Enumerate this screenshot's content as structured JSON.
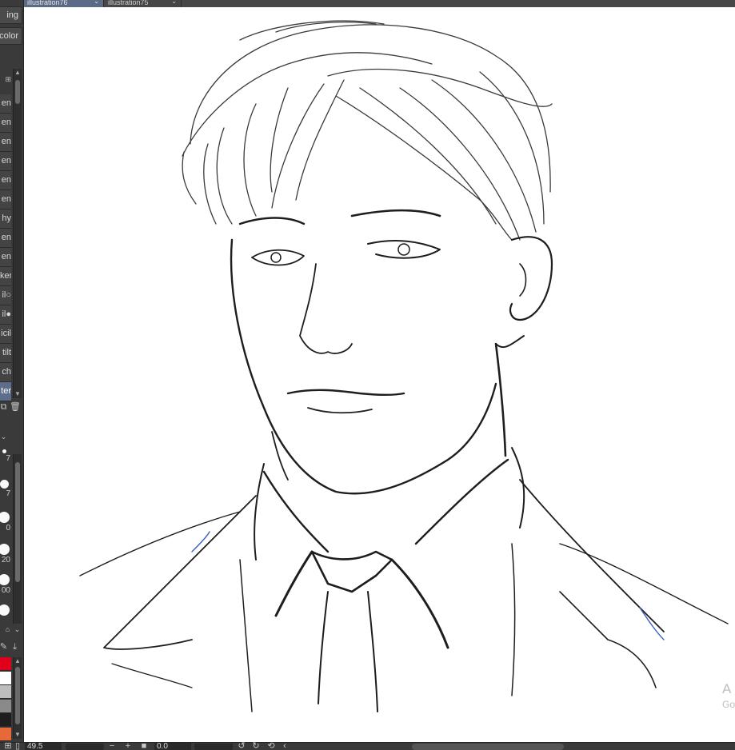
{
  "tabs": [
    {
      "label": "illustration76",
      "active": true
    },
    {
      "label": "illustration75",
      "active": false
    }
  ],
  "tool_panel": {
    "top_buttons": [
      "ing",
      "color"
    ],
    "subtool_header": "⊞",
    "subtools": [
      "en",
      "en",
      "en",
      "en",
      "en",
      "en",
      "hy",
      "en",
      "en",
      "ker",
      "il○",
      "il●",
      "icil",
      "tilt",
      "ch",
      "ter"
    ],
    "active_subtool_index": 15
  },
  "brush_sizes": [
    "7",
    "7",
    "0",
    "20",
    "00"
  ],
  "colors": [
    "#e0001a",
    "#ffffff",
    "#bdbdbd",
    "#8a8a8a",
    "#1e1e1e",
    "#e8683a"
  ],
  "status_bar": {
    "zoom": "49.5",
    "minus": "−",
    "plus": "+",
    "angle": "0.0"
  },
  "watermark": {
    "line1": "A",
    "line2": "Go"
  }
}
